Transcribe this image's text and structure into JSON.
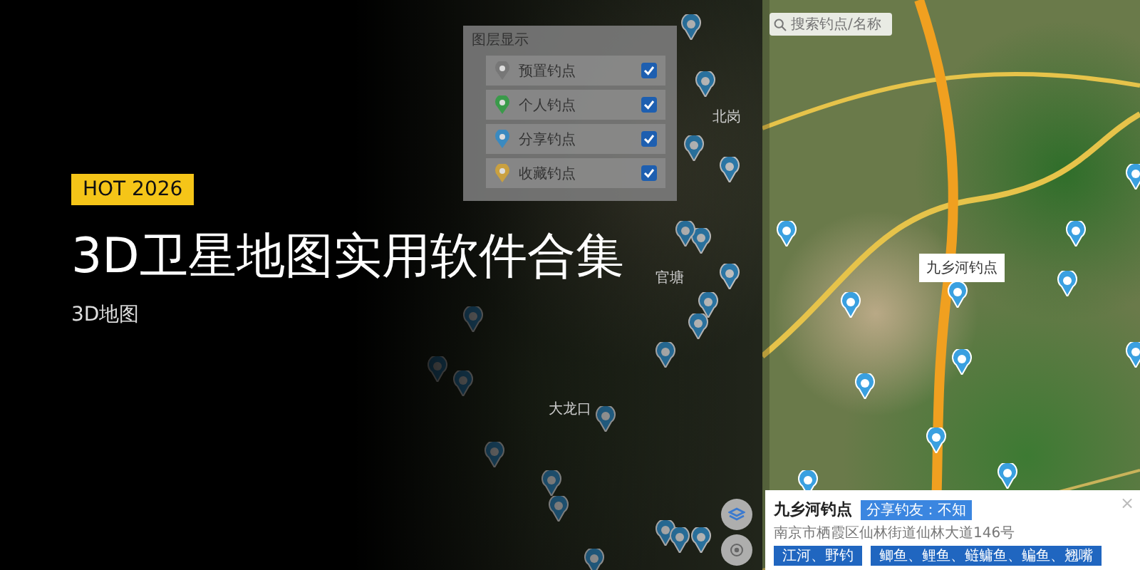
{
  "badge": "HOT 2026",
  "title": "3D卫星地图实用软件合集",
  "subtitle": "3D地图",
  "left_app": {
    "layer_panel": {
      "title": "图层显示",
      "items": [
        {
          "label": "预置钓点",
          "checked": true
        },
        {
          "label": "个人钓点",
          "checked": true
        },
        {
          "label": "分享钓点",
          "checked": true
        },
        {
          "label": "收藏钓点",
          "checked": true
        }
      ]
    },
    "map_labels": [
      "北岗",
      "官塘",
      "大龙口"
    ]
  },
  "right_app": {
    "search": {
      "placeholder": "搜索钓点/名称"
    },
    "marker_label": "九乡河钓点",
    "card": {
      "title": "九乡河钓点",
      "sharer": "分享钓友：不知",
      "address": "南京市栖霞区仙林街道仙林大道146号",
      "tags": [
        "江河、野钓",
        "鲫鱼、鲤鱼、鲢鳙鱼、鳊鱼、翘嘴"
      ],
      "close": "×"
    }
  }
}
